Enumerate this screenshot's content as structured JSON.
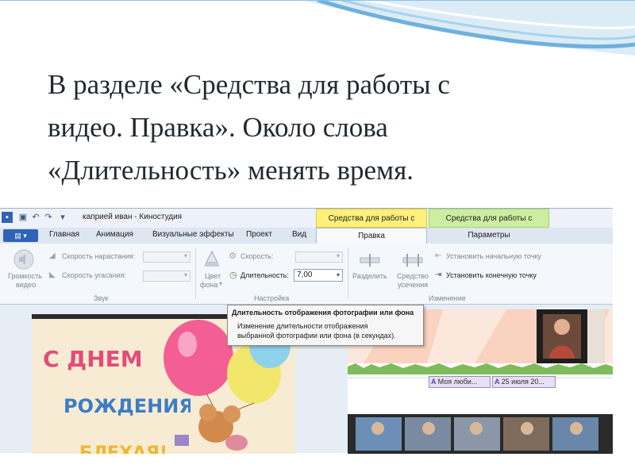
{
  "slide": {
    "lines": [
      "В разделе «Средства для работы с",
      "видео. Правка». Около слова",
      "«Длительность» менять время."
    ]
  },
  "window": {
    "title": "каприей иван - Киностудия",
    "context_tabs": {
      "video": "Средства для работы с видео",
      "music": "Средства для работы с музыкой"
    },
    "tabs": [
      "Главная",
      "Анимация",
      "Визуальные эффекты",
      "Проект",
      "Вид"
    ],
    "active_tab": "Правка",
    "params_tab": "Параметры"
  },
  "ribbon": {
    "volume_label_1": "Громкость",
    "volume_label_2": "видео",
    "fade_in_label": "Скорость нарастания:",
    "fade_out_label": "Скорость угасания:",
    "group_sound": "Звук",
    "bg_color_label_1": "Цвет",
    "bg_color_label_2": "фона",
    "speed_label": "Скорость:",
    "duration_label": "Длительность:",
    "duration_value": "7,00",
    "group_settings": "Настройка",
    "split_label": "Разделить",
    "trim_label_1": "Средство",
    "trim_label_2": "усечения",
    "set_start_label": "Установить начальную точку",
    "set_end_label": "Установить конечную точку",
    "group_edit": "Изменение"
  },
  "tooltip": {
    "title": "Длительность отображения фотографии или фона",
    "body_1": "Изменение длительности отображения",
    "body_2": "выбранной фотографии или фона (в секундах)."
  },
  "timeline": {
    "captions": [
      "Моя люби...",
      "25 июля 20..."
    ]
  },
  "colors": {
    "video_context": "#fff07a",
    "music_context": "#cdeea0",
    "file_button": "#2f63b6"
  }
}
